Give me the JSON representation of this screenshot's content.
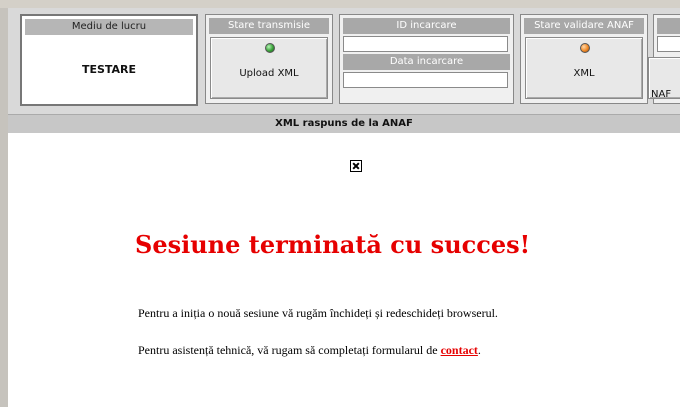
{
  "panels": {
    "mediu": {
      "title": "Mediu de lucru",
      "value": "TESTARE"
    },
    "transmisie": {
      "title": "Stare transmisie",
      "button_label": "Upload XML",
      "led_color": "#39a239"
    },
    "incarcare": {
      "id_title": "ID incarcare",
      "id_value": "",
      "date_title": "Data incarcare",
      "date_value": ""
    },
    "validare": {
      "title": "Stare validare ANAF",
      "button_label": "XML",
      "led_color": "#f08a28"
    },
    "partial": {
      "button_label": "NAF"
    }
  },
  "response_bar": {
    "title": "XML raspuns de la ANAF"
  },
  "message": {
    "headline": "Sesiune terminată cu succes!",
    "line1": "Pentru a iniția o nouă sesiune vă rugăm închideți și redeschideți browserul.",
    "line2_prefix": "Pentru asistență tehnică, vă rugam să completați formularul de ",
    "link_text": "contact",
    "line2_suffix": "."
  },
  "icons": {
    "broken": "close-icon"
  }
}
